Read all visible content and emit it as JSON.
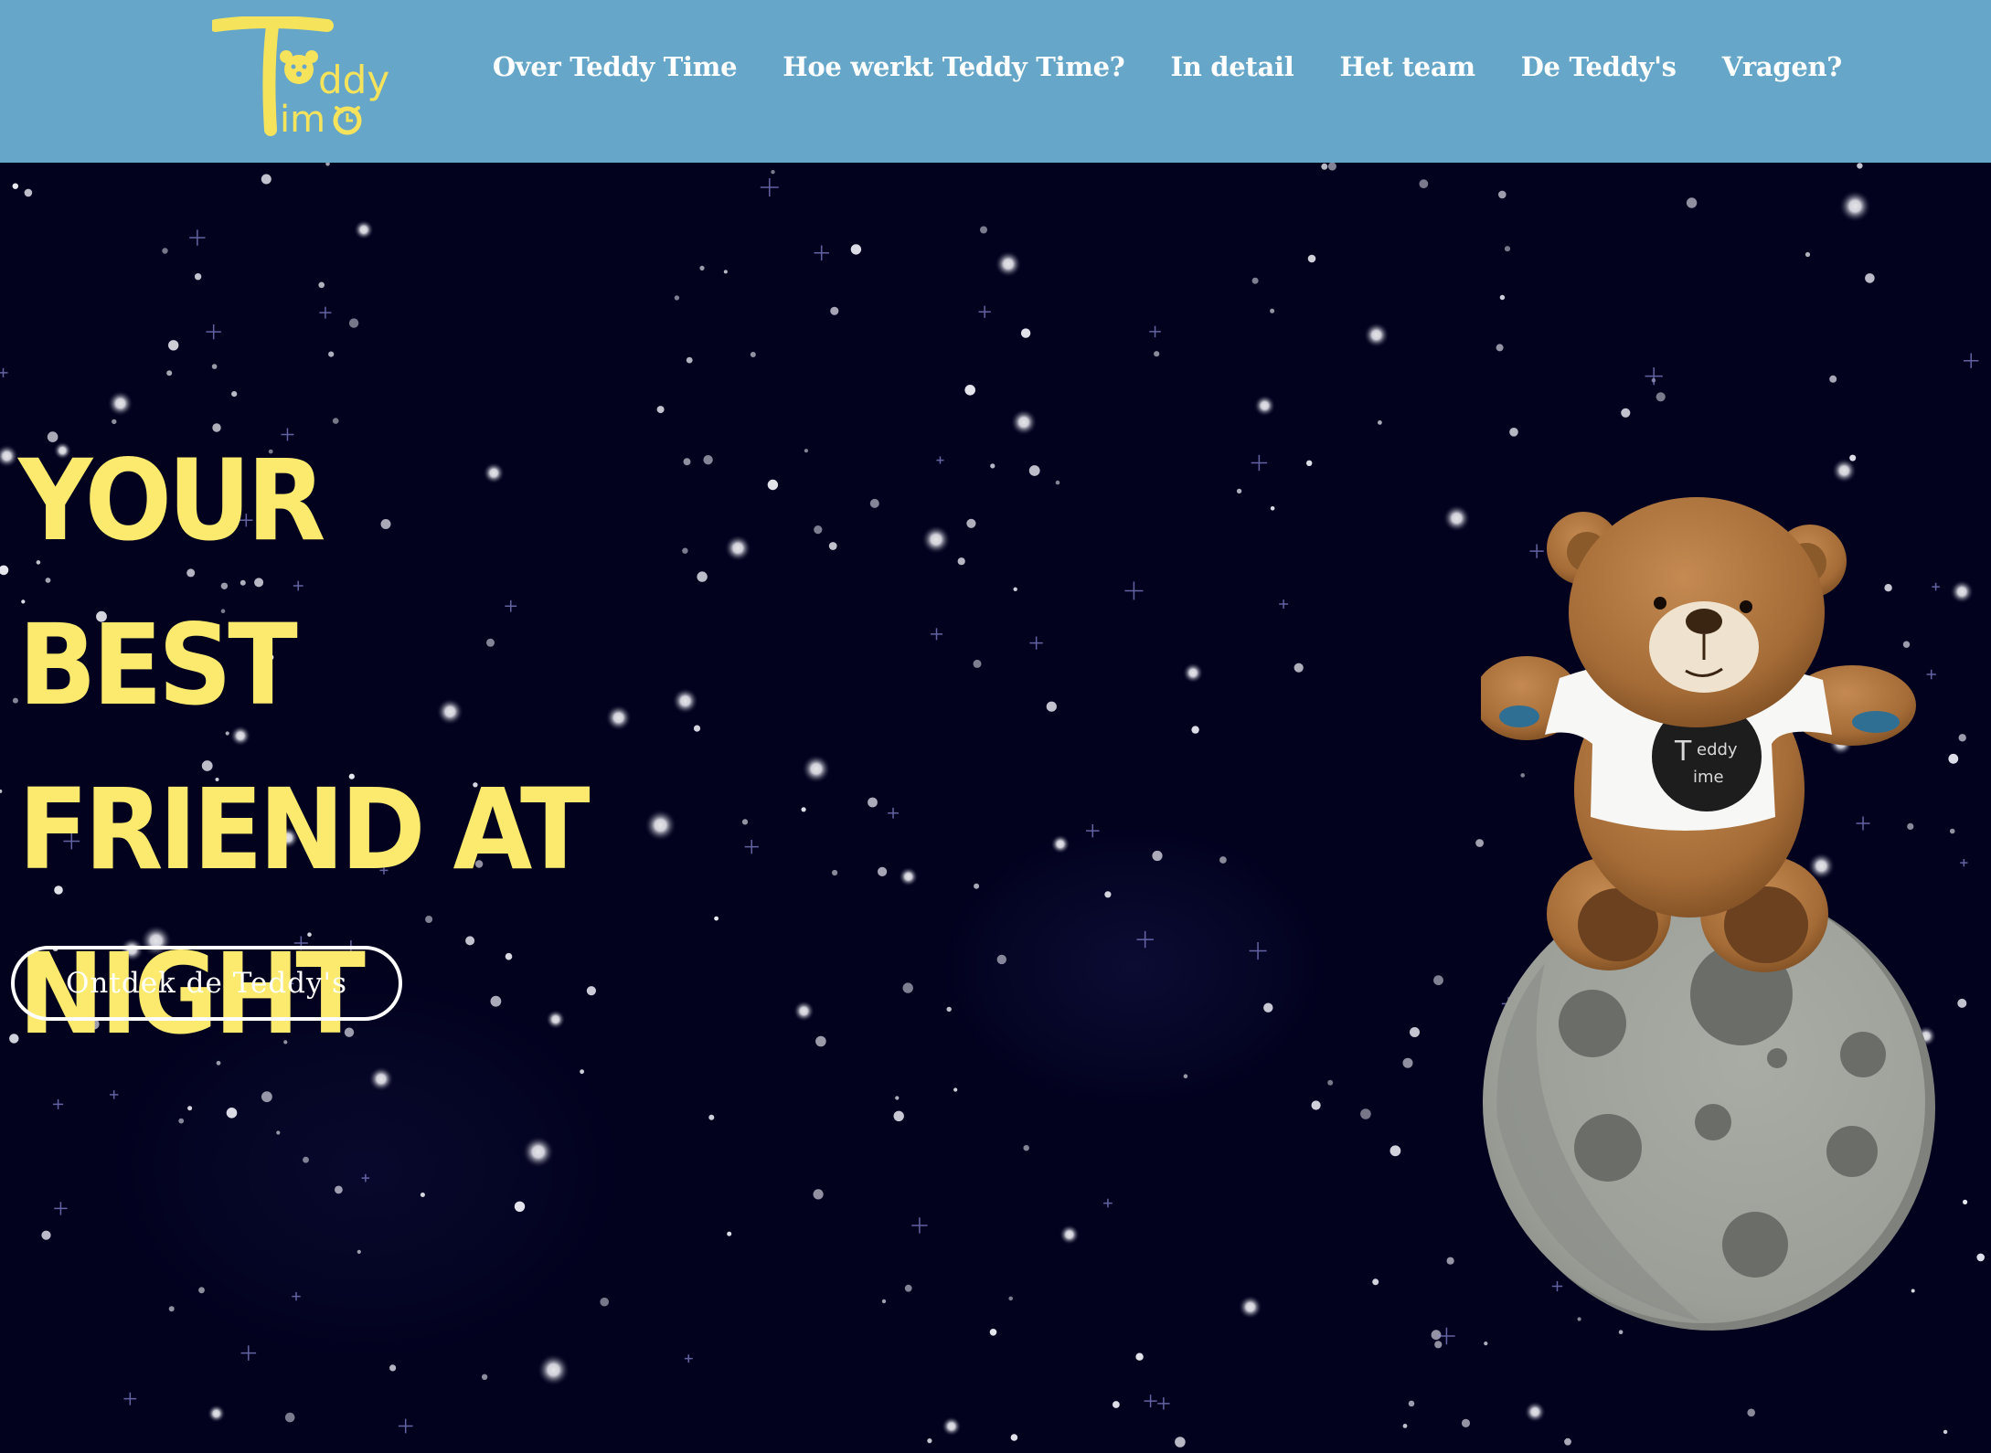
{
  "brand": {
    "logo_alt": "Teddy Time"
  },
  "nav": {
    "items": [
      {
        "label": "Over Teddy Time"
      },
      {
        "label": "Hoe werkt Teddy Time?"
      },
      {
        "label": "In detail"
      },
      {
        "label": "Het team"
      },
      {
        "label": "De Teddy's"
      },
      {
        "label": "Vragen?"
      }
    ]
  },
  "hero": {
    "headline": "YOUR BEST FRIEND AT NIGHT",
    "cta_label": "Ontdek de Teddy's"
  },
  "colors": {
    "header_bg": "#66a7c9",
    "hero_bg": "#02021f",
    "headline": "#fbea6e",
    "logo": "#f6e35c"
  },
  "icons": {
    "logo": "teddy-time-logo",
    "illustration": "teddy-bear-on-moon"
  }
}
